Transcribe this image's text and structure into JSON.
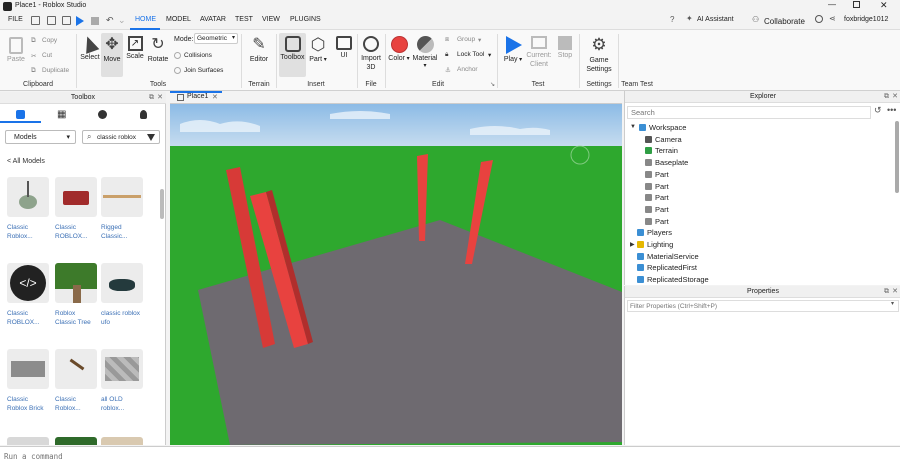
{
  "window": {
    "title": "Place1 - Roblox Studio"
  },
  "menubar": {
    "file": "FILE",
    "tabs": [
      "HOME",
      "MODEL",
      "AVATAR",
      "TEST",
      "VIEW",
      "PLUGINS"
    ],
    "active_tab": "HOME",
    "ai_assistant": "AI Assistant",
    "collaborate": "Collaborate",
    "username": "foxbridge1012"
  },
  "ribbon": {
    "clipboard": {
      "paste": "Paste",
      "copy": "Copy",
      "cut": "Cut",
      "duplicate": "Duplicate",
      "label": "Clipboard"
    },
    "tools": {
      "select": "Select",
      "move": "Move",
      "scale": "Scale",
      "rotate": "Rotate",
      "mode_label": "Mode:",
      "mode_value": "Geometric",
      "collisions": "Collisions",
      "join_surfaces": "Join Surfaces",
      "label": "Tools"
    },
    "terrain": {
      "editor": "Editor",
      "label": "Terrain"
    },
    "insert": {
      "toolbox": "Toolbox",
      "part": "Part",
      "ui": "UI",
      "label": "Insert"
    },
    "file": {
      "import3d": "Import 3D",
      "label": "File"
    },
    "edit": {
      "color": "Color",
      "material": "Material",
      "group": "Group",
      "lock_tool": "Lock Tool",
      "anchor": "Anchor",
      "label": "Edit"
    },
    "test": {
      "play": "Play",
      "current_client": "Current: Client",
      "stop": "Stop",
      "label": "Test"
    },
    "settings": {
      "game_settings": "Game Settings",
      "label": "Settings"
    },
    "team_test": {
      "label": "Team Test"
    }
  },
  "toolbox": {
    "title": "Toolbox",
    "category": "Models",
    "search_value": "classic roblox",
    "back_link": "< All Models",
    "models": [
      {
        "name": "Classic Roblox..."
      },
      {
        "name": "Classic ROBLOX..."
      },
      {
        "name": "Rigged Classic..."
      },
      {
        "name": "Classic ROBLOX..."
      },
      {
        "name": "Roblox Classic Tree"
      },
      {
        "name": "classic roblox ufo"
      },
      {
        "name": "Classic Roblox Brick"
      },
      {
        "name": "Classic Roblox..."
      },
      {
        "name": "all OLD roblox..."
      }
    ]
  },
  "document": {
    "tab": "Place1"
  },
  "explorer": {
    "title": "Explorer",
    "search_placeholder": "Search",
    "items": [
      {
        "label": "Workspace",
        "icon": "globe-icon",
        "color": "#3b8fd4"
      },
      {
        "label": "Camera",
        "icon": "camera-icon",
        "color": "#555555"
      },
      {
        "label": "Terrain",
        "icon": "terrain-icon",
        "color": "#2f9e44"
      },
      {
        "label": "Baseplate",
        "icon": "part-icon",
        "color": "#888888"
      },
      {
        "label": "Part",
        "icon": "part-icon",
        "color": "#888888"
      },
      {
        "label": "Part",
        "icon": "part-icon",
        "color": "#888888"
      },
      {
        "label": "Part",
        "icon": "part-icon",
        "color": "#888888"
      },
      {
        "label": "Part",
        "icon": "part-icon",
        "color": "#888888"
      },
      {
        "label": "Part",
        "icon": "part-icon",
        "color": "#888888"
      },
      {
        "label": "Players",
        "icon": "players-icon",
        "color": "#3b8fd4"
      },
      {
        "label": "Lighting",
        "icon": "lightbulb-icon",
        "color": "#e6b800"
      },
      {
        "label": "MaterialService",
        "icon": "material-icon",
        "color": "#3b8fd4"
      },
      {
        "label": "ReplicatedFirst",
        "icon": "replicated-first-icon",
        "color": "#3b8fd4"
      },
      {
        "label": "ReplicatedStorage",
        "icon": "replicated-storage-icon",
        "color": "#3b8fd4"
      }
    ]
  },
  "properties": {
    "title": "Properties",
    "filter_placeholder": "Filter Properties (Ctrl+Shift+P)"
  },
  "command_bar": {
    "placeholder": "Run a command"
  },
  "colors": {
    "accent": "#1a73e8",
    "sky": "#9ec8ee",
    "grass": "#2ea82e",
    "baseplate": "#6e6a70",
    "part_red": "#e8423f",
    "play_blue": "#1a73e8"
  }
}
